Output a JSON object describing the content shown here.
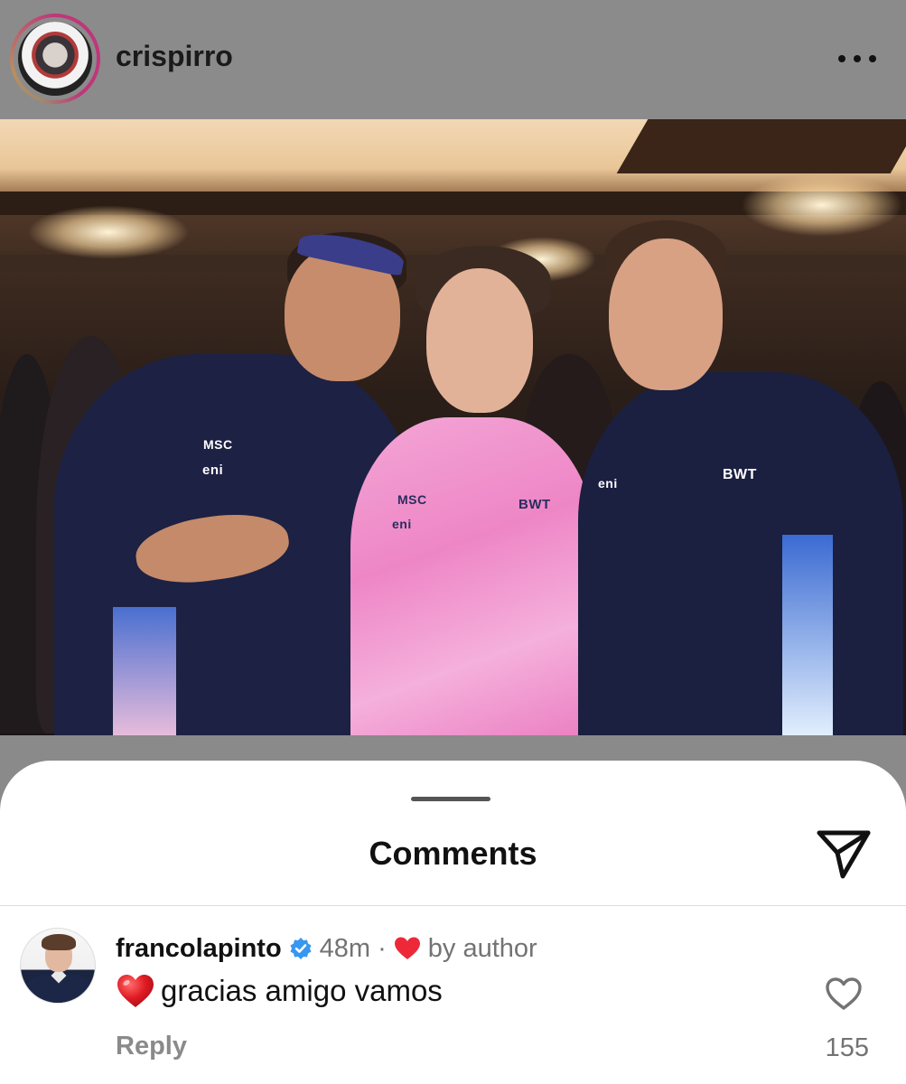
{
  "post": {
    "username": "crispirro",
    "more_icon": "more-horizontal-icon"
  },
  "comments_sheet": {
    "title": "Comments",
    "share_icon": "paper-plane-icon"
  },
  "comment": {
    "username": "francolapinto",
    "verified": true,
    "time": "48m",
    "separator": "·",
    "liked_by_author_label": "by author",
    "text": "gracias amigo vamos",
    "reply_label": "Reply",
    "like_count": "155"
  },
  "colors": {
    "header_bg": "#8b8b8b",
    "verified_blue": "#3897f0",
    "heart_red": "#ed2939",
    "muted_text": "#737373"
  }
}
